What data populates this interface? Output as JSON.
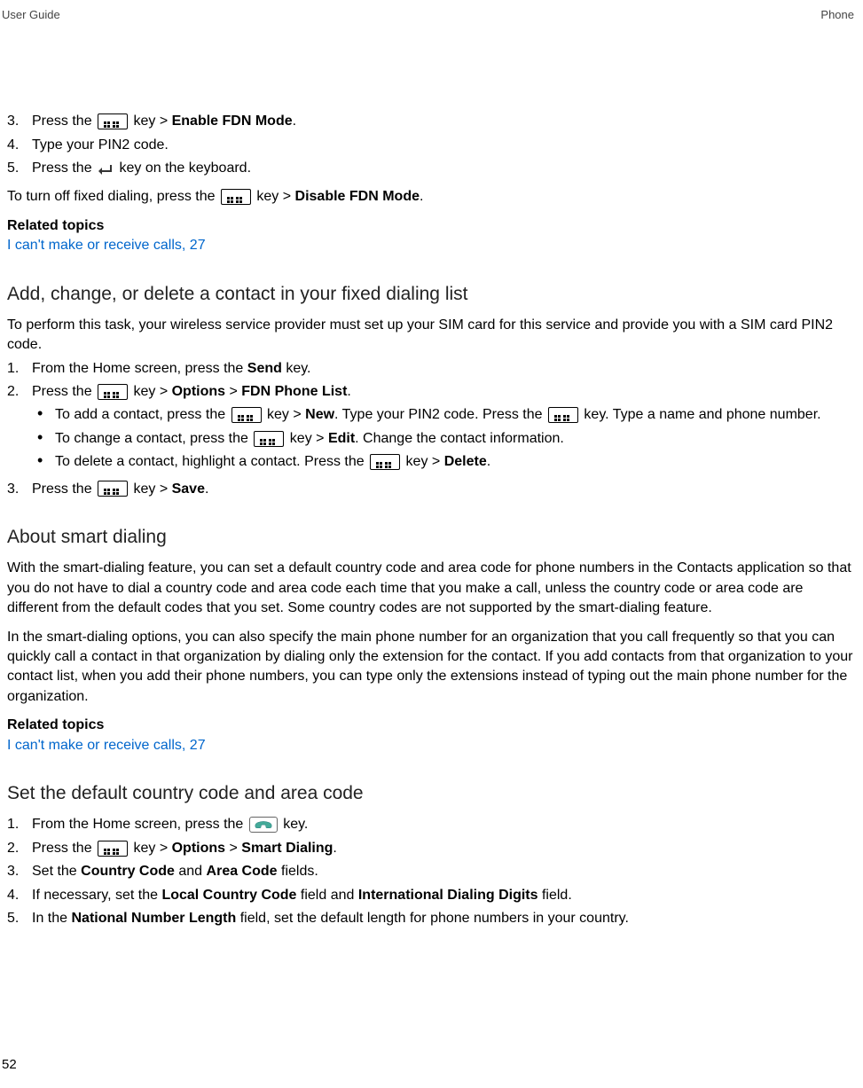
{
  "header": {
    "left": "User Guide",
    "right": "Phone"
  },
  "section1": {
    "items": [
      {
        "num": "3.",
        "pre": "Press the ",
        "post": " key > ",
        "bold": "Enable FDN Mode",
        "end": "."
      },
      {
        "num": "4.",
        "text": "Type your PIN2 code."
      },
      {
        "num": "5.",
        "pre": "Press the ",
        "post": " key on the keyboard."
      }
    ],
    "turnoff_pre": "To turn off fixed dialing, press the ",
    "turnoff_mid": " key > ",
    "turnoff_bold": "Disable FDN Mode",
    "turnoff_end": "."
  },
  "related1": {
    "heading": "Related topics",
    "link": "I can't make or receive calls, 27"
  },
  "section2": {
    "heading": "Add, change, or delete a contact in your fixed dialing list",
    "intro": "To perform this task, your wireless service provider must set up your SIM card for this service and provide you with a SIM card PIN2 code.",
    "step1_num": "1.",
    "step1_pre": "From the Home screen, press the ",
    "step1_bold": "Send",
    "step1_post": " key.",
    "step2_num": "2.",
    "step2_pre": "Press the ",
    "step2_mid": " key > ",
    "step2_bold1": "Options",
    "step2_gt": " > ",
    "step2_bold2": "FDN Phone List",
    "step2_end": ".",
    "bullet1_pre": "To add a contact, press the ",
    "bullet1_mid1": " key > ",
    "bullet1_bold1": "New",
    "bullet1_mid2": ". Type your PIN2 code. Press the ",
    "bullet1_post": " key. Type a name and phone number.",
    "bullet2_pre": "To change a contact, press the ",
    "bullet2_mid": " key > ",
    "bullet2_bold": "Edit",
    "bullet2_post": ". Change the contact information.",
    "bullet3_pre": "To delete a contact, highlight a contact. Press the ",
    "bullet3_mid": " key > ",
    "bullet3_bold": "Delete",
    "bullet3_end": ".",
    "step3_num": "3.",
    "step3_pre": "Press the ",
    "step3_mid": " key > ",
    "step3_bold": "Save",
    "step3_end": "."
  },
  "section3": {
    "heading": "About smart dialing",
    "para1": "With the smart-dialing feature, you can set a default country code and area code for phone numbers in the Contacts application so that you do not have to dial a country code and area code each time that you make a call, unless the country code or area code are different from the default codes that you set. Some country codes are not supported by the smart-dialing feature.",
    "para2": "In the smart-dialing options, you can also specify the main phone number for an organization that you call frequently so that you can quickly call a contact in that organization by dialing only the extension for the contact. If you add contacts from that organization to your contact list, when you add their phone numbers, you can type only the extensions instead of typing out the main phone number for the organization."
  },
  "related2": {
    "heading": "Related topics",
    "link": "I can't make or receive calls, 27"
  },
  "section4": {
    "heading": "Set the default country code and area code",
    "step1_num": "1.",
    "step1_pre": "From the Home screen, press the ",
    "step1_post": " key.",
    "step2_num": "2.",
    "step2_pre": "Press the ",
    "step2_mid": " key > ",
    "step2_bold1": "Options",
    "step2_gt": " > ",
    "step2_bold2": "Smart Dialing",
    "step2_end": ".",
    "step3_num": "3.",
    "step3_pre": "Set the ",
    "step3_bold1": "Country Code",
    "step3_mid": " and ",
    "step3_bold2": "Area Code",
    "step3_post": " fields.",
    "step4_num": "4.",
    "step4_pre": "If necessary, set the ",
    "step4_bold1": "Local Country Code",
    "step4_mid": " field and ",
    "step4_bold2": "International Dialing Digits",
    "step4_post": " field.",
    "step5_num": "5.",
    "step5_pre": "In the ",
    "step5_bold": "National Number Length",
    "step5_post": " field, set the default length for phone numbers in your country."
  },
  "pagenum": "52"
}
